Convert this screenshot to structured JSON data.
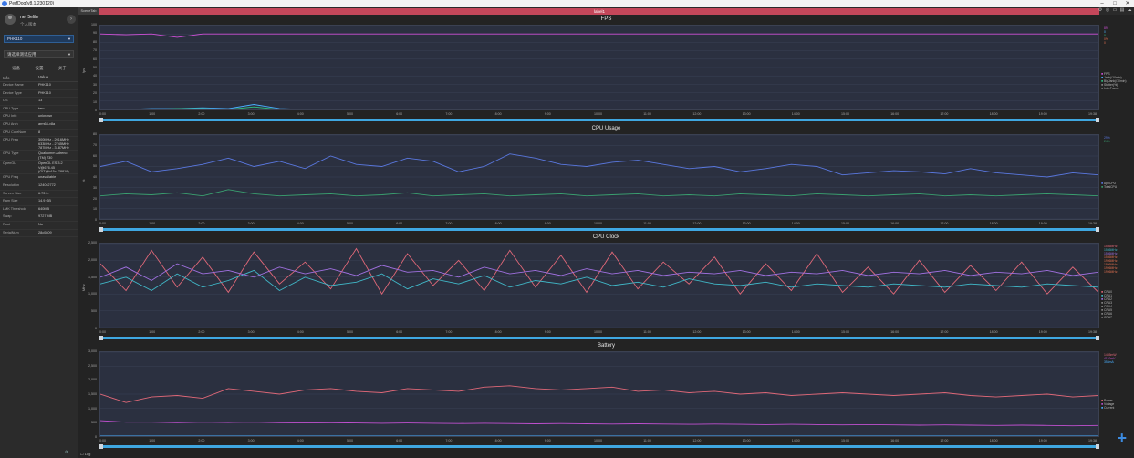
{
  "window": {
    "title": "PerfDog(v8.1.230120)",
    "controls": [
      "–",
      "□",
      "✕"
    ]
  },
  "sidebar": {
    "user_name": "net 5elife",
    "user_sub": "个人版本",
    "device_select": "PHK110",
    "app_select": "请选择测试应用",
    "tabs": [
      "设备",
      "设置",
      "关于"
    ],
    "info_header": {
      "k": "Info",
      "v": "Value"
    },
    "info": [
      {
        "k": "Device Name",
        "v": "PHK110"
      },
      {
        "k": "Device Type",
        "v": "PHK110"
      },
      {
        "k": "OS",
        "v": "13"
      },
      {
        "k": "CPU Type",
        "v": "taro"
      },
      {
        "k": "CPU Info",
        "v": "unknown"
      },
      {
        "k": "CPU Arch",
        "v": "arm64-v8a"
      },
      {
        "k": "CPU CoreNum",
        "v": "8"
      },
      {
        "k": "CPU Freq",
        "v": "300MHz - 2016MHz\n633MHz - 2745MHz\n787MHz - 3187MHz"
      },
      {
        "k": "GPU Type",
        "v": "Qualcomm Adreno\n(TM) 730"
      },
      {
        "k": "OpenGL",
        "v": "OpenGL ES 3.2\nV@676.45\n(GIT@b15c178819)"
      },
      {
        "k": "GPU Freq",
        "v": "unavailable"
      },
      {
        "k": "Resolution",
        "v": "1240x2772"
      },
      {
        "k": "Screen Size",
        "v": "6.73 in"
      },
      {
        "k": "Ram Size",
        "v": "14.9 GB"
      },
      {
        "k": "LMK Threshold",
        "v": "640MB"
      },
      {
        "k": "Swap",
        "v": "9727 MB"
      },
      {
        "k": "Root",
        "v": "No"
      },
      {
        "k": "SerialNum",
        "v": "28c0809"
      }
    ]
  },
  "main": {
    "scene_tab": "SceneTab",
    "label_bar": "label1",
    "log_button": "Log"
  },
  "colors": {
    "label_bar": "#c4475a",
    "plot_bg": "#2b3040",
    "scroll": "#3fa7e0",
    "stats_text": "#4aa0ff"
  },
  "x_ticks": [
    "0:00",
    "1:00",
    "2:00",
    "3:00",
    "4:00",
    "5:00",
    "6:00",
    "7:00",
    "8:00",
    "9:00",
    "10:00",
    "11:00",
    "12:00",
    "13:00",
    "14:00",
    "15:00",
    "16:00",
    "17:00",
    "18:00",
    "19:00",
    "19:38"
  ],
  "chart_data": [
    {
      "type": "line",
      "title": "FPS",
      "ylabel": "fps",
      "ylim": [
        0,
        100
      ],
      "yticks": [
        "100",
        "90",
        "80",
        "70",
        "60",
        "50",
        "40",
        "30",
        "20",
        "10",
        "0"
      ],
      "series": [
        {
          "name": "FPS",
          "color": "#d050d8",
          "values": [
            90,
            89,
            90,
            86,
            90,
            90,
            90,
            90,
            90,
            90,
            90,
            90,
            90,
            90,
            90,
            90,
            90,
            90,
            90,
            90,
            90,
            90,
            90,
            90,
            90,
            90,
            90,
            90,
            90,
            90,
            90,
            90,
            90,
            90,
            90,
            90,
            90,
            90,
            90,
            90
          ]
        },
        {
          "name": "Jank(/10min)",
          "color": "#4ab0ff",
          "values": [
            0,
            0,
            1,
            1,
            2,
            1,
            6,
            1,
            0,
            0,
            0,
            0,
            0,
            0,
            0,
            0,
            0,
            0,
            0,
            0,
            0,
            0,
            0,
            0,
            0,
            0,
            0,
            0,
            0,
            0,
            0,
            0,
            0,
            0,
            0,
            0,
            0,
            0,
            0,
            0
          ]
        },
        {
          "name": "Stutter(%)",
          "color": "#30c080",
          "values": [
            0,
            0,
            0,
            1,
            1,
            0,
            3,
            0,
            0,
            0,
            0,
            0,
            0,
            0,
            0,
            0,
            0,
            0,
            0,
            0,
            0,
            0,
            0,
            0,
            0,
            0,
            0,
            0,
            0,
            0,
            0,
            0,
            0,
            0,
            0,
            0,
            0,
            0,
            0,
            0
          ]
        }
      ],
      "legend": [
        "FPS",
        "Jank(/10min)",
        "BigJank(/10min)",
        "Stutter(%)",
        "InterFrame"
      ],
      "right_values": [
        "89",
        "0",
        "0",
        "0%",
        "0"
      ]
    },
    {
      "type": "line",
      "title": "CPU Usage",
      "ylabel": "%",
      "ylim": [
        0,
        80
      ],
      "yticks": [
        "80",
        "70",
        "60",
        "50",
        "40",
        "30",
        "20",
        "10",
        "0"
      ],
      "series": [
        {
          "name": "AppCPU",
          "color": "#5a78e0",
          "values": [
            50,
            55,
            45,
            48,
            52,
            58,
            50,
            55,
            48,
            60,
            52,
            50,
            58,
            55,
            45,
            50,
            62,
            58,
            52,
            50,
            54,
            56,
            52,
            48,
            50,
            45,
            48,
            52,
            50,
            42,
            44,
            46,
            45,
            43,
            48,
            44,
            42,
            40,
            44,
            42
          ]
        },
        {
          "name": "TotalCPU",
          "color": "#3aa070",
          "values": [
            22,
            24,
            23,
            25,
            22,
            28,
            24,
            22,
            23,
            24,
            22,
            23,
            25,
            22,
            23,
            24,
            22,
            23,
            24,
            22,
            23,
            24,
            22,
            23,
            22,
            24,
            23,
            22,
            24,
            23,
            22,
            23,
            24,
            22,
            23,
            22,
            23,
            24,
            23,
            22
          ]
        }
      ],
      "legend": [
        "AppCPU",
        "TotalCPU"
      ],
      "right_values": [
        "29%",
        "24%"
      ]
    },
    {
      "type": "line",
      "title": "CPU Clock",
      "ylabel": "MHz",
      "ylim": [
        0,
        2500
      ],
      "yticks": [
        "2,500",
        "2,000",
        "1,500",
        "1,000",
        "500",
        "0"
      ],
      "series": [
        {
          "name": "CPU0",
          "color": "#e06878",
          "values": [
            1900,
            1100,
            2300,
            1200,
            2100,
            1050,
            2250,
            1300,
            1950,
            1150,
            2350,
            1000,
            2200,
            1250,
            2000,
            1100,
            2300,
            1200,
            2150,
            1050,
            2250,
            1150,
            1950,
            1300,
            2100,
            1000,
            1900,
            1100,
            2200,
            1050,
            1800,
            1000,
            2000,
            1050,
            1850,
            1100,
            1950,
            1000,
            1800,
            1050
          ]
        },
        {
          "name": "CPU4",
          "color": "#40b8c8",
          "values": [
            1300,
            1500,
            1100,
            1600,
            1200,
            1400,
            1700,
            1100,
            1500,
            1250,
            1350,
            1600,
            1150,
            1450,
            1300,
            1550,
            1200,
            1400,
            1300,
            1500,
            1250,
            1350,
            1200,
            1450,
            1300,
            1250,
            1350,
            1200,
            1300,
            1250,
            1200,
            1300,
            1250,
            1200,
            1300,
            1250,
            1200,
            1300,
            1250,
            1200
          ]
        },
        {
          "name": "CPU7",
          "color": "#a070e0",
          "values": [
            1500,
            1800,
            1400,
            1900,
            1600,
            1700,
            1500,
            1800,
            1600,
            1750,
            1550,
            1850,
            1650,
            1700,
            1500,
            1800,
            1600,
            1700,
            1550,
            1750,
            1600,
            1700,
            1550,
            1650,
            1600,
            1700,
            1550,
            1650,
            1600,
            1700,
            1550,
            1650,
            1600,
            1700,
            1550,
            1650,
            1600,
            1700,
            1550,
            1650
          ]
        }
      ],
      "legend": [
        "CPU0",
        "CPU1",
        "CPU2",
        "CPU3",
        "CPU4",
        "CPU5",
        "CPU6",
        "CPU7"
      ],
      "right_values": [
        "1536MHz",
        "1536MHz",
        "1536MHz",
        "1536MHz",
        "1996MHz",
        "1996MHz",
        "1996MHz",
        "1996MHz"
      ]
    },
    {
      "type": "line",
      "title": "Battery",
      "ylabel": "",
      "ylim": [
        0,
        3000
      ],
      "yticks": [
        "3,000",
        "2,500",
        "2,000",
        "1,500",
        "1,000",
        "500",
        "0"
      ],
      "series": [
        {
          "name": "Power",
          "color": "#e06878",
          "values": [
            1500,
            1200,
            1400,
            1450,
            1350,
            1700,
            1600,
            1500,
            1650,
            1700,
            1600,
            1550,
            1700,
            1650,
            1600,
            1750,
            1800,
            1700,
            1650,
            1700,
            1750,
            1600,
            1650,
            1550,
            1600,
            1500,
            1550,
            1450,
            1500,
            1550,
            1500,
            1450,
            1500,
            1550,
            1450,
            1400,
            1450,
            1500,
            1400,
            1450
          ]
        },
        {
          "name": "Voltage",
          "color": "#c050d0",
          "values": [
            550,
            500,
            500,
            480,
            500,
            490,
            500,
            480,
            470,
            480,
            470,
            460,
            470,
            460,
            450,
            460,
            450,
            440,
            450,
            440,
            430,
            440,
            430,
            420,
            430,
            420,
            410,
            420,
            410,
            400,
            410,
            400,
            390,
            400,
            390,
            380,
            390,
            380,
            370,
            380
          ]
        },
        {
          "name": "Current",
          "color": "#4ab0ff",
          "values": [
            0,
            0,
            0,
            0,
            0,
            0,
            0,
            0,
            0,
            0,
            0,
            0,
            0,
            0,
            0,
            0,
            0,
            0,
            0,
            0,
            0,
            0,
            0,
            0,
            0,
            0,
            0,
            0,
            0,
            0,
            0,
            0,
            0,
            0,
            0,
            0,
            0,
            0,
            0,
            0
          ]
        }
      ],
      "legend": [
        "Power",
        "Voltage",
        "Current"
      ],
      "right_values": [
        "1455mW",
        "4110mV",
        "354mA"
      ]
    }
  ]
}
